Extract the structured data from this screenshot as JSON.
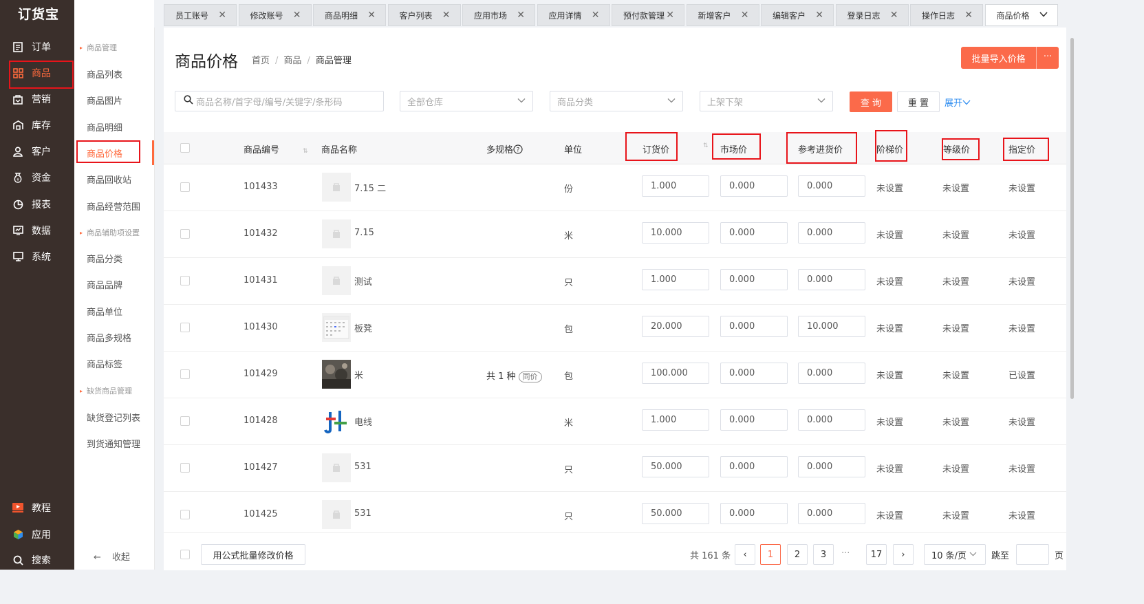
{
  "app": {
    "logo": "订货宝"
  },
  "nav": {
    "items": [
      {
        "label": "订单",
        "icon": "order-icon"
      },
      {
        "label": "商品",
        "icon": "grid-icon"
      },
      {
        "label": "营销",
        "icon": "bag-icon"
      },
      {
        "label": "库存",
        "icon": "warehouse-icon"
      },
      {
        "label": "客户",
        "icon": "user-icon"
      },
      {
        "label": "资金",
        "icon": "money-icon"
      },
      {
        "label": "报表",
        "icon": "pie-icon"
      },
      {
        "label": "数据",
        "icon": "data-icon"
      },
      {
        "label": "系统",
        "icon": "monitor-icon"
      }
    ],
    "bottom": [
      {
        "label": "教程",
        "icon": "video-icon"
      },
      {
        "label": "应用",
        "icon": "cube-icon"
      },
      {
        "label": "搜索",
        "icon": "search-icon"
      }
    ],
    "accent": "#ff6a3d"
  },
  "submenu": {
    "group1": "商品管理",
    "items1": [
      "商品列表",
      "商品图片",
      "商品明细",
      "商品价格",
      "商品回收站",
      "商品经营范围"
    ],
    "group2": "商品辅助项设置",
    "items2": [
      "商品分类",
      "商品品牌",
      "商品单位",
      "商品多规格",
      "商品标签"
    ],
    "group3": "缺货商品管理",
    "items3": [
      "缺货登记列表",
      "到货通知管理"
    ],
    "collapse": "收起"
  },
  "tabs": [
    "员工账号",
    "修改账号",
    "商品明细",
    "客户列表",
    "应用市场",
    "应用详情",
    "预付款管理",
    "新增客户",
    "编辑客户",
    "登录日志",
    "操作日志",
    "商品价格"
  ],
  "page": {
    "title": "商品价格",
    "breadcrumb": [
      "首页",
      "商品",
      "商品管理"
    ],
    "import_button": "批量导入价格",
    "more_button": "···"
  },
  "filters": {
    "search_placeholder": "商品名称/首字母/编号/关键字/条形码",
    "warehouse": "全部仓库",
    "category": "商品分类",
    "status": "上架下架",
    "query": "查 询",
    "reset": "重 置",
    "expand": "展开"
  },
  "table": {
    "headers": {
      "code": "商品编号",
      "name": "商品名称",
      "spec": "多规格",
      "unit": "单位",
      "order_price": "订货价",
      "market_price": "市场价",
      "ref_price": "参考进货价",
      "tier_price": "阶梯价",
      "level_price": "等级价",
      "assigned_price": "指定价"
    },
    "rows": [
      {
        "code": "101433",
        "name": "7.15 二",
        "spec": "",
        "spec_tag": "",
        "unit": "份",
        "order": "1.000",
        "market": "0.000",
        "ref": "0.000",
        "tier": "未设置",
        "level": "未设置",
        "assigned": "未设置",
        "thumb": "placeholder"
      },
      {
        "code": "101432",
        "name": "7.15",
        "spec": "",
        "spec_tag": "",
        "unit": "米",
        "order": "10.000",
        "market": "0.000",
        "ref": "0.000",
        "tier": "未设置",
        "level": "未设置",
        "assigned": "未设置",
        "thumb": "placeholder"
      },
      {
        "code": "101431",
        "name": "测试",
        "spec": "",
        "spec_tag": "",
        "unit": "只",
        "order": "1.000",
        "market": "0.000",
        "ref": "0.000",
        "tier": "未设置",
        "level": "未设置",
        "assigned": "未设置",
        "thumb": "placeholder"
      },
      {
        "code": "101430",
        "name": "板凳",
        "spec": "",
        "spec_tag": "",
        "unit": "包",
        "order": "20.000",
        "market": "0.000",
        "ref": "10.000",
        "tier": "未设置",
        "level": "未设置",
        "assigned": "未设置",
        "thumb": "calendar"
      },
      {
        "code": "101429",
        "name": "米",
        "spec": "共 1 种",
        "spec_tag": "同价",
        "unit": "包",
        "order": "100.000",
        "market": "0.000",
        "ref": "0.000",
        "tier": "未设置",
        "level": "未设置",
        "assigned": "已设置",
        "thumb": "photo"
      },
      {
        "code": "101428",
        "name": "电线",
        "spec": "",
        "spec_tag": "",
        "unit": "米",
        "order": "1.000",
        "market": "0.000",
        "ref": "0.000",
        "tier": "未设置",
        "level": "未设置",
        "assigned": "未设置",
        "thumb": "logo"
      },
      {
        "code": "101427",
        "name": "531",
        "spec": "",
        "spec_tag": "",
        "unit": "只",
        "order": "50.000",
        "market": "0.000",
        "ref": "0.000",
        "tier": "未设置",
        "level": "未设置",
        "assigned": "未设置",
        "thumb": "placeholder"
      },
      {
        "code": "101425",
        "name": "531",
        "spec": "",
        "spec_tag": "",
        "unit": "只",
        "order": "50.000",
        "market": "0.000",
        "ref": "0.000",
        "tier": "未设置",
        "level": "未设置",
        "assigned": "未设置",
        "thumb": "placeholder"
      }
    ]
  },
  "footer": {
    "batch_button": "用公式批量修改价格",
    "total": "共 161 条",
    "pages": [
      "1",
      "2",
      "3",
      "···",
      "17"
    ],
    "page_size": "10 条/页",
    "jump_label": "跳至",
    "page_unit": "页"
  }
}
